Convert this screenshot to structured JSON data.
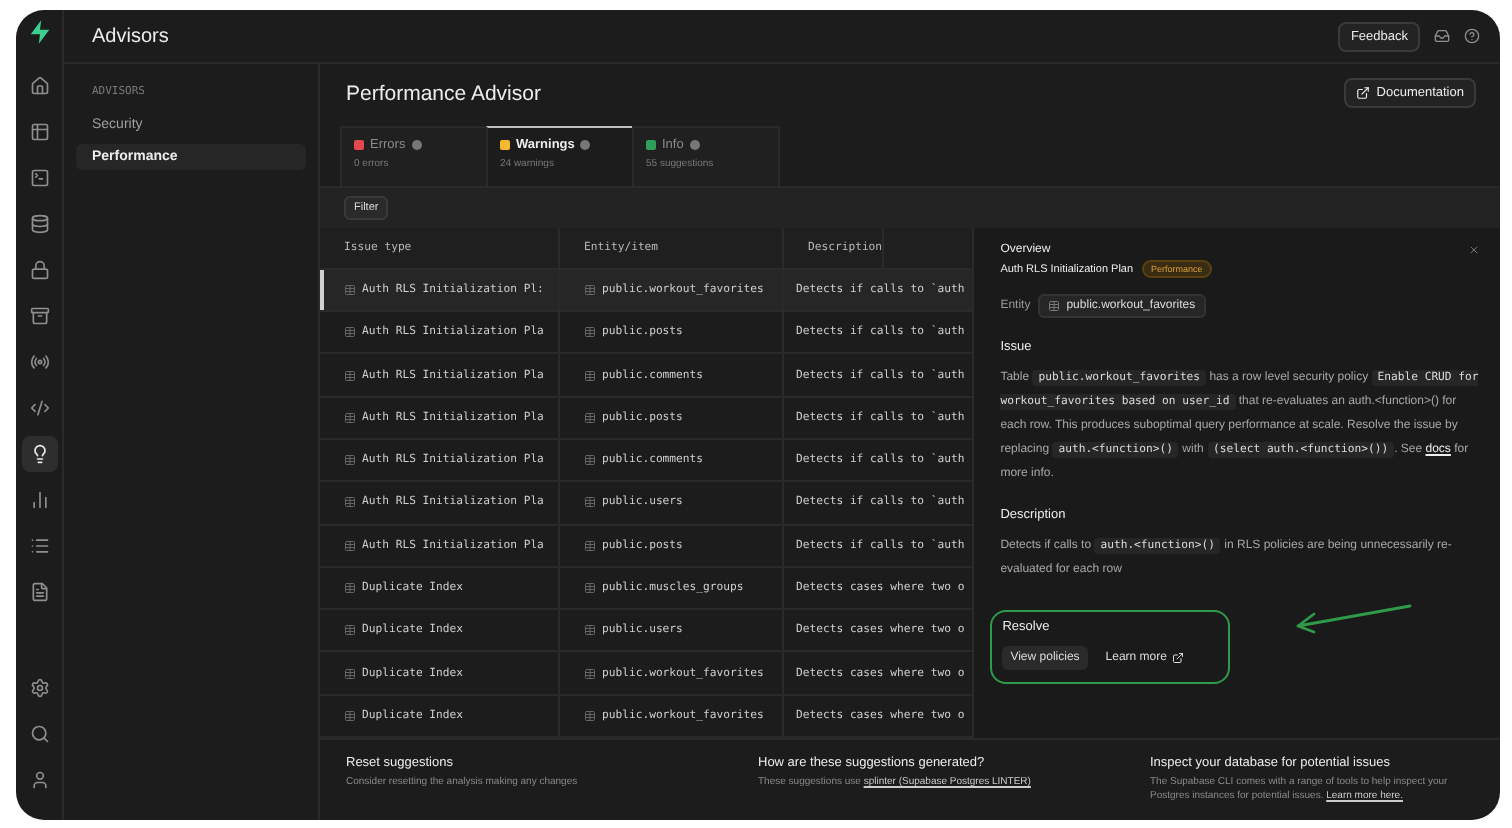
{
  "header": {
    "title": "Advisors",
    "feedback": "Feedback"
  },
  "rail": {
    "items": [
      {
        "kind": "home",
        "selected": false
      },
      {
        "kind": "table",
        "selected": false
      },
      {
        "kind": "terminal",
        "selected": false
      },
      {
        "kind": "database",
        "selected": false
      },
      {
        "kind": "lock",
        "selected": false
      },
      {
        "kind": "storage",
        "selected": false
      },
      {
        "kind": "realtime",
        "selected": false
      },
      {
        "kind": "functions",
        "selected": false
      },
      {
        "kind": "advisor",
        "selected": true
      },
      {
        "kind": "reports",
        "selected": false
      },
      {
        "kind": "logs",
        "selected": false
      },
      {
        "kind": "docs",
        "selected": false
      }
    ],
    "bottom": [
      {
        "kind": "settings"
      },
      {
        "kind": "search"
      },
      {
        "kind": "avatar"
      }
    ]
  },
  "nav": {
    "heading": "ADVISORS",
    "items": [
      {
        "label": "Security",
        "selected": false
      },
      {
        "label": "Performance",
        "selected": true
      }
    ]
  },
  "page": {
    "title": "Performance Advisor",
    "documentation": "Documentation"
  },
  "tabs": [
    {
      "label": "Errors",
      "count": "0 errors",
      "color": "#e5484d",
      "selected": false
    },
    {
      "label": "Warnings",
      "count": "24 warnings",
      "color": "#f5b82e",
      "selected": true
    },
    {
      "label": "Info",
      "count": "55 suggestions",
      "color": "#2f9e5b",
      "selected": false
    }
  ],
  "filter": "Filter",
  "table": {
    "columns": [
      "Issue type",
      "Entity/item",
      "Description"
    ],
    "rows": [
      {
        "issue_type": "Auth RLS Initialization Pl:",
        "entity": "public.workout_favorites",
        "description": "Detects if calls to `auth",
        "selected": true
      },
      {
        "issue_type": "Auth RLS Initialization Pla",
        "entity": "public.posts",
        "description": "Detects if calls to `auth",
        "selected": false
      },
      {
        "issue_type": "Auth RLS Initialization Pla",
        "entity": "public.comments",
        "description": "Detects if calls to `auth",
        "selected": false
      },
      {
        "issue_type": "Auth RLS Initialization Pla",
        "entity": "public.posts",
        "description": "Detects if calls to `auth",
        "selected": false
      },
      {
        "issue_type": "Auth RLS Initialization Pla",
        "entity": "public.comments",
        "description": "Detects if calls to `auth",
        "selected": false
      },
      {
        "issue_type": "Auth RLS Initialization Pla",
        "entity": "public.users",
        "description": "Detects if calls to `auth",
        "selected": false
      },
      {
        "issue_type": "Auth RLS Initialization Pla",
        "entity": "public.posts",
        "description": "Detects if calls to `auth",
        "selected": false
      },
      {
        "issue_type": "Duplicate Index",
        "entity": "public.muscles_groups",
        "description": "Detects cases where two o",
        "selected": false
      },
      {
        "issue_type": "Duplicate Index",
        "entity": "public.users",
        "description": "Detects cases where two o",
        "selected": false
      },
      {
        "issue_type": "Duplicate Index",
        "entity": "public.workout_favorites",
        "description": "Detects cases where two o",
        "selected": false
      },
      {
        "issue_type": "Duplicate Index",
        "entity": "public.workout_favorites",
        "description": "Detects cases where two o",
        "selected": false
      }
    ]
  },
  "panel": {
    "heading": "Overview",
    "title": "Auth RLS Initialization Plan",
    "badge": "Performance",
    "entity_label": "Entity",
    "entity": "public.workout_favorites",
    "issue_heading": "Issue",
    "issue": [
      {
        "kind": "text",
        "text": "Table "
      },
      {
        "kind": "code",
        "text": "public.workout_favorites"
      },
      {
        "kind": "text",
        "text": " has a row level security policy "
      },
      {
        "kind": "code",
        "text": "Enable CRUD for workout_favorites based on user_id"
      },
      {
        "kind": "text",
        "text": " that re-evaluates an auth.<function>() for each row. This produces suboptimal query performance at scale. Resolve the issue by replacing "
      },
      {
        "kind": "code",
        "text": "auth.<function>()"
      },
      {
        "kind": "text",
        "text": " with "
      },
      {
        "kind": "code",
        "text": "(select auth.<function>())"
      },
      {
        "kind": "text",
        "text": ". See "
      },
      {
        "kind": "link",
        "text": "docs"
      },
      {
        "kind": "text",
        "text": " for more info."
      }
    ],
    "description_heading": "Description",
    "description": [
      {
        "kind": "text",
        "text": "Detects if calls to "
      },
      {
        "kind": "code",
        "text": "auth.<function>()"
      },
      {
        "kind": "text",
        "text": " in RLS policies are being unnecessarily re-evaluated for each row"
      }
    ],
    "resolve_heading": "Resolve",
    "view_policies": "View policies",
    "learn_more": "Learn more"
  },
  "footer": [
    {
      "title": "Reset suggestions",
      "text": [
        {
          "kind": "text",
          "text": "Consider resetting the analysis making any changes"
        }
      ]
    },
    {
      "title": "How are these suggestions generated?",
      "text": [
        {
          "kind": "text",
          "text": "These suggestions use "
        },
        {
          "kind": "link",
          "text": "splinter (Supabase Postgres LINTER)"
        }
      ]
    },
    {
      "title": "Inspect your database for potential issues",
      "text": [
        {
          "kind": "text",
          "text": "The Supabase CLI comes with a range of tools to help inspect your Postgres instances for potential issues. "
        },
        {
          "kind": "link",
          "text": "Learn more here."
        }
      ]
    }
  ]
}
